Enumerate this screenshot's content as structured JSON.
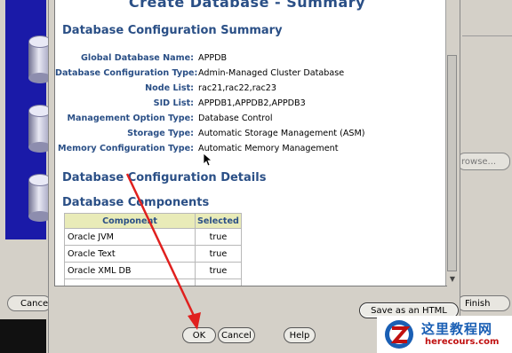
{
  "background": {
    "cancel_label": "Cancel",
    "finish_label": "Finish",
    "browse_label": "rowse..."
  },
  "dialog": {
    "heading": "Create Database - Summary",
    "section_summary": "Database Configuration Summary",
    "summary_rows": [
      {
        "label": "Global Database Name:",
        "value": "APPDB"
      },
      {
        "label": "Database Configuration Type:",
        "value": "Admin-Managed Cluster Database"
      },
      {
        "label": "Node List:",
        "value": "rac21,rac22,rac23"
      },
      {
        "label": "SID List:",
        "value": "APPDB1,APPDB2,APPDB3"
      },
      {
        "label": "Management Option Type:",
        "value": "Database Control"
      },
      {
        "label": "Storage Type:",
        "value": "Automatic Storage Management (ASM)"
      },
      {
        "label": "Memory Configuration Type:",
        "value": "Automatic Memory Management"
      }
    ],
    "section_details": "Database Configuration Details",
    "section_components": "Database Components",
    "components_table": {
      "headers": [
        "Component",
        "Selected"
      ],
      "rows": [
        [
          "Oracle JVM",
          "true"
        ],
        [
          "Oracle Text",
          "true"
        ],
        [
          "Oracle XML DB",
          "true"
        ]
      ]
    },
    "save_html_label": "Save as an HTML file...",
    "ok_label": "OK",
    "cancel_label": "Cancel",
    "help_label": "Help"
  },
  "watermark": {
    "title": "这里教程网",
    "url": "herecours.com"
  },
  "colors": {
    "heading": "#2a4f86",
    "table_header_bg": "#e9ebb8",
    "arrow": "#e0201e"
  }
}
